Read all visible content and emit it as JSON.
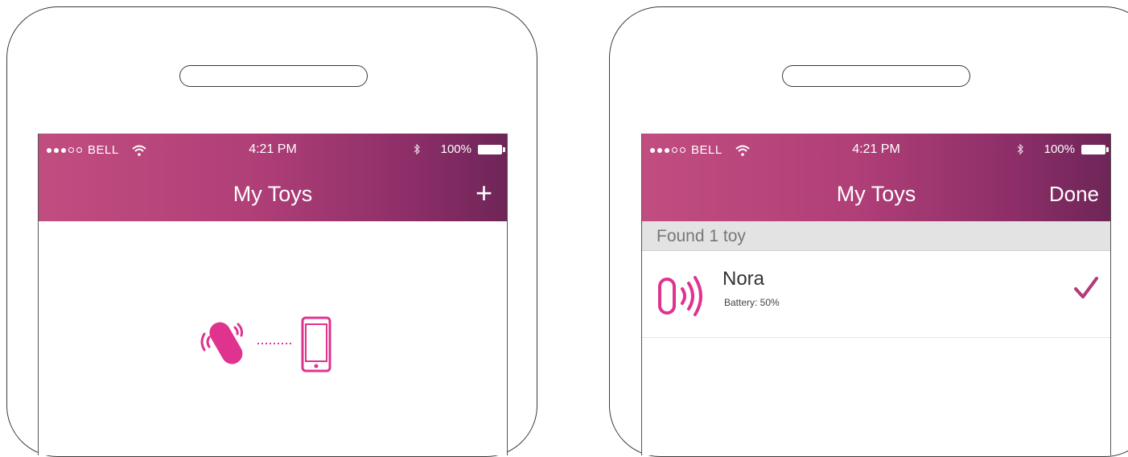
{
  "left_screen": {
    "status": {
      "carrier": "BELL",
      "time": "4:21 PM",
      "battery": "100%"
    },
    "title": "My Toys",
    "action_label": "+"
  },
  "right_screen": {
    "status": {
      "carrier": "BELL",
      "time": "4:21 PM",
      "battery": "100%"
    },
    "title": "My Toys",
    "action_label": "Done",
    "section_header": "Found 1 toy",
    "toys": [
      {
        "name": "Nora",
        "battery": "Battery: 50%",
        "selected": true
      }
    ]
  },
  "colors": {
    "accent": "#e0338f",
    "navbar_start": "#c14d80",
    "navbar_end": "#6e2558",
    "section_bg": "#e3e3e3"
  },
  "icons": [
    "wifi-icon",
    "bluetooth-icon",
    "battery-icon",
    "plus-icon",
    "vibrator-icon",
    "phone-icon",
    "bluetooth-toy-icon",
    "checkmark-icon"
  ]
}
